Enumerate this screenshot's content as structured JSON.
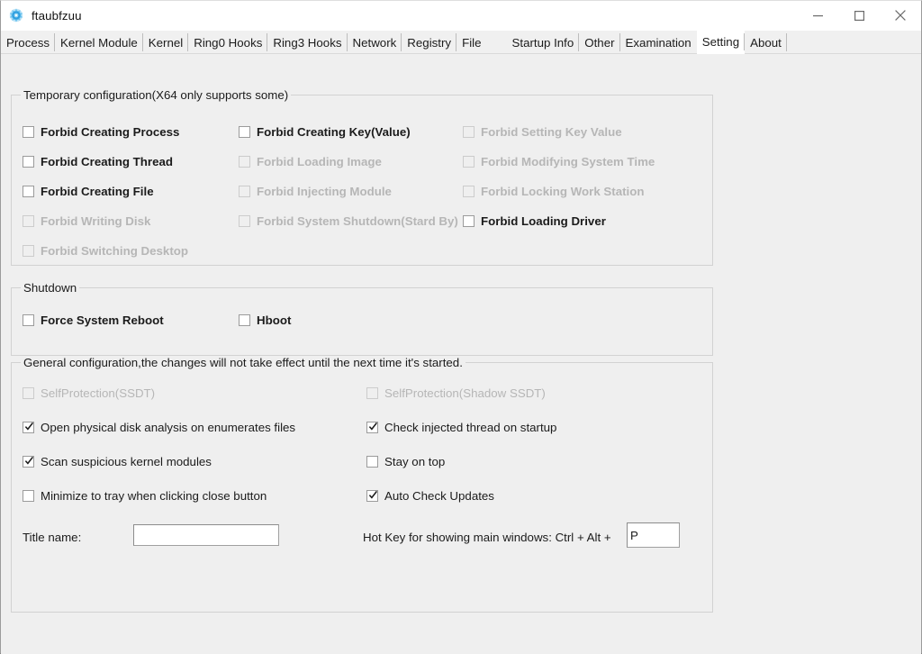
{
  "window": {
    "title": "ftaubfzuu",
    "icon": "app-gear-icon",
    "minimize_label": "─",
    "maximize_label": "□",
    "close_label": "✕"
  },
  "menubar": {
    "items": [
      {
        "label": "Process",
        "selected": false
      },
      {
        "label": "Kernel Module",
        "selected": false
      },
      {
        "label": "Kernel",
        "selected": false
      },
      {
        "label": "Ring0 Hooks",
        "selected": false
      },
      {
        "label": "Ring3 Hooks",
        "selected": false
      },
      {
        "label": "Network",
        "selected": false
      },
      {
        "label": "Registry",
        "selected": false
      },
      {
        "label": "File",
        "selected": false
      },
      {
        "label": "Startup Info",
        "selected": false
      },
      {
        "label": "Other",
        "selected": false
      },
      {
        "label": "Examination",
        "selected": false
      },
      {
        "label": "Setting",
        "selected": true
      },
      {
        "label": "About",
        "selected": false
      }
    ]
  },
  "temporary_group": {
    "title": "Temporary configuration(X64 only supports some)",
    "items": [
      {
        "label": "Forbid Creating Process",
        "checked": false,
        "disabled": false
      },
      {
        "label": "Forbid Creating Thread",
        "checked": false,
        "disabled": false
      },
      {
        "label": "Forbid Creating File",
        "checked": false,
        "disabled": false
      },
      {
        "label": "Forbid Writing Disk",
        "checked": false,
        "disabled": true
      },
      {
        "label": "Forbid Switching Desktop",
        "checked": false,
        "disabled": true
      },
      {
        "label": "Forbid Creating Key(Value)",
        "checked": false,
        "disabled": false
      },
      {
        "label": "Forbid Loading Image",
        "checked": false,
        "disabled": true
      },
      {
        "label": "Forbid Injecting Module",
        "checked": false,
        "disabled": true
      },
      {
        "label": "Forbid System Shutdown(Stard By)",
        "checked": false,
        "disabled": true
      },
      {
        "label": "Forbid Setting Key Value",
        "checked": false,
        "disabled": true
      },
      {
        "label": "Forbid Modifying System Time",
        "checked": false,
        "disabled": true
      },
      {
        "label": "Forbid Locking Work Station",
        "checked": false,
        "disabled": true
      },
      {
        "label": "Forbid Loading Driver",
        "checked": false,
        "disabled": false
      }
    ]
  },
  "shutdown_group": {
    "title": "Shutdown",
    "items": [
      {
        "label": "Force System Reboot",
        "checked": false,
        "disabled": false
      },
      {
        "label": "Hboot",
        "checked": false,
        "disabled": false
      }
    ]
  },
  "general_group": {
    "title": "General configuration,the changes will not take effect until the next time it's started.",
    "items": [
      {
        "label": "SelfProtection(SSDT)",
        "checked": false,
        "disabled": true
      },
      {
        "label": "Open physical disk analysis on enumerates files",
        "checked": true,
        "disabled": false
      },
      {
        "label": "Scan suspicious kernel modules",
        "checked": true,
        "disabled": false
      },
      {
        "label": "Minimize to tray when clicking close button",
        "checked": false,
        "disabled": false
      },
      {
        "label": "SelfProtection(Shadow SSDT)",
        "checked": false,
        "disabled": true
      },
      {
        "label": "Check injected thread on startup",
        "checked": true,
        "disabled": false
      },
      {
        "label": "Stay on top",
        "checked": false,
        "disabled": false
      },
      {
        "label": "Auto Check Updates",
        "checked": true,
        "disabled": false
      }
    ],
    "title_name_label": "Title name:",
    "title_name_value": "",
    "title_name_placeholder": "",
    "hotkey_label": "Hot Key for showing main windows: Ctrl + Alt +",
    "hotkey_value": "P"
  },
  "colors": {
    "window_bg": "#efefef",
    "titlebar_bg": "#ffffff",
    "menubar_bg": "#f0f0f0",
    "accent_icon": "#2e9fe0",
    "text": "#1b1b1b",
    "disabled_text": "#b6b6b6",
    "groupbox_border": "#d2d2d2"
  }
}
